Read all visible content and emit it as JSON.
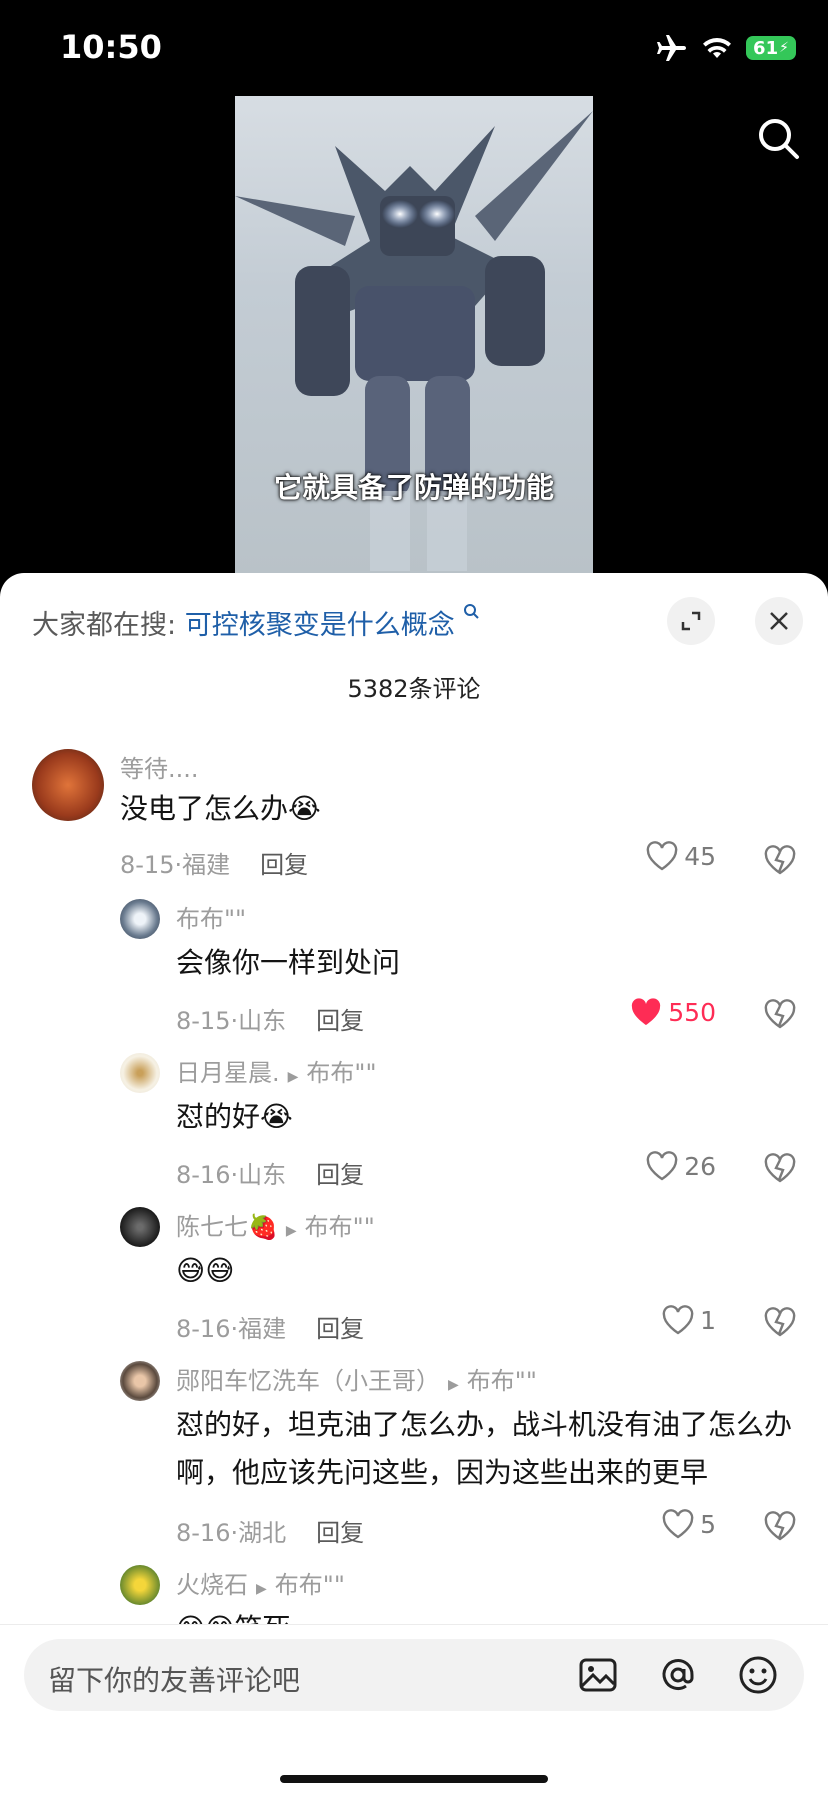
{
  "status_bar": {
    "time": "10:50",
    "battery": "61"
  },
  "video": {
    "subtitle": "它就具备了防弹的功能"
  },
  "sheet": {
    "search_prefix": "大家都在搜:",
    "search_term": "可控核聚变是什么概念",
    "comment_count": "5382条评论"
  },
  "comments": [
    {
      "name": "等待....",
      "reply_to": "",
      "text": "没电了怎么办😭",
      "date": "8-15",
      "location": "福建",
      "reply": "回复",
      "likes": "45",
      "liked": false
    },
    {
      "name": "布布\"\"",
      "reply_to": "",
      "text": "会像你一样到处问",
      "date": "8-15",
      "location": "山东",
      "reply": "回复",
      "likes": "550",
      "liked": true
    },
    {
      "name": "日月星晨.",
      "reply_to": "布布\"\"",
      "text": "怼的好😭",
      "date": "8-16",
      "location": "山东",
      "reply": "回复",
      "likes": "26",
      "liked": false
    },
    {
      "name": "陈七七🍓",
      "reply_to": "布布\"\"",
      "text": "😅😅",
      "date": "8-16",
      "location": "福建",
      "reply": "回复",
      "likes": "1",
      "liked": false
    },
    {
      "name": "郧阳车忆洗车（小王哥）",
      "reply_to": "布布\"\"",
      "text": "怼的好，坦克油了怎么办，战斗机没有油了怎么办啊，他应该先问这些，因为这些出来的更早",
      "date": "8-16",
      "location": "湖北",
      "reply": "回复",
      "likes": "5",
      "liked": false
    },
    {
      "name": "火烧石",
      "reply_to": "布布\"\"",
      "text": "😅😅笑死",
      "date": "",
      "location": "",
      "reply": "",
      "likes": "",
      "liked": false
    }
  ],
  "input": {
    "placeholder": "留下你的友善评论吧"
  },
  "colors": {
    "link": "#1f5fa8",
    "like_active": "#fe2c55",
    "battery": "#34c759"
  },
  "icons": [
    "airplane-icon",
    "wifi-icon",
    "search-icon",
    "expand-icon",
    "close-icon",
    "heart-icon",
    "dislike-icon",
    "image-icon",
    "at-icon",
    "emoji-icon"
  ]
}
